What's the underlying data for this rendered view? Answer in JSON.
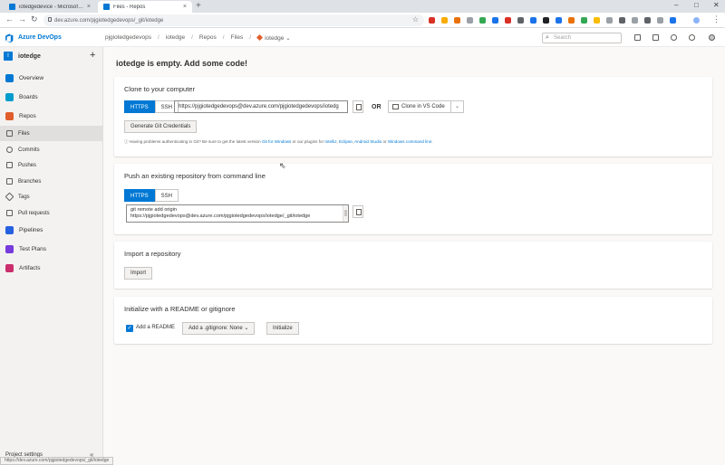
{
  "browser": {
    "tabs": [
      {
        "title": "iotedgedevice - Microsoft Azure",
        "active": false
      },
      {
        "title": "Files - Repos",
        "active": true
      }
    ],
    "address": "dev.azure.com/pjgiotedgedevops/_git/iotedge",
    "status_url": "https://dev.azure.com/pjgiotedgedevops/_git/iotedge",
    "window_controls": {
      "minimize": "–",
      "maximize": "□",
      "close": "✕"
    }
  },
  "header": {
    "app_name": "Azure DevOps",
    "breadcrumbs": [
      "pjgiotedgedevops",
      "iotedge",
      "Repos",
      "Files",
      "iotedge"
    ],
    "search_placeholder": "Search"
  },
  "sidebar": {
    "project_badge": "I",
    "project_name": "iotedge",
    "add_icon": "+",
    "items": [
      {
        "label": "Overview",
        "color": "#0078d4"
      },
      {
        "label": "Boards",
        "color": "#009ccc"
      },
      {
        "label": "Repos",
        "color": "#e05e2b"
      },
      {
        "label": "Files",
        "selected": true
      },
      {
        "label": "Commits"
      },
      {
        "label": "Pushes"
      },
      {
        "label": "Branches"
      },
      {
        "label": "Tags"
      },
      {
        "label": "Pull requests"
      },
      {
        "label": "Pipelines",
        "color": "#2560e0"
      },
      {
        "label": "Test Plans",
        "color": "#773adc"
      },
      {
        "label": "Artifacts",
        "color": "#cb2e6d"
      }
    ],
    "settings_label": "Project settings",
    "collapse_icon": "«"
  },
  "main": {
    "title": "iotedge is empty. Add some code!",
    "clone": {
      "heading": "Clone to your computer",
      "tabs": [
        "HTTPS",
        "SSH"
      ],
      "url": "https://pjgiotedgedevops@dev.azure.com/pjgiotedgedevops/iotedg",
      "or_label": "OR",
      "ide_button": "Clone in VS Code",
      "credentials_button": "Generate Git Credentials",
      "info_prefix": "Having problems authenticating in Git? Be sure to get the latest version ",
      "info_link1": "Git for Windows",
      "info_mid": " or our plugins for ",
      "info_link2": "IntelliJ",
      "info_sep1": ", ",
      "info_link3": "Eclipse",
      "info_sep2": ", ",
      "info_link4": "Android Studio",
      "info_or": " or ",
      "info_link5": "Windows command line",
      "info_end": "."
    },
    "push": {
      "heading": "Push an existing repository from command line",
      "tabs": [
        "HTTPS",
        "SSH"
      ],
      "cmd_line1": "git remote add origin",
      "cmd_line2": "https://pjgiotedgedevops@dev.azure.com/pjgiotedgedevops/iotedge/_git/iotedge"
    },
    "import": {
      "heading": "Import a repository",
      "button": "Import"
    },
    "init": {
      "heading": "Initialize with a README or gitignore",
      "readme_label": "Add a README",
      "readme_checked": true,
      "gitignore_button": "Add a .gitignore: None",
      "initialize_button": "Initialize"
    }
  }
}
